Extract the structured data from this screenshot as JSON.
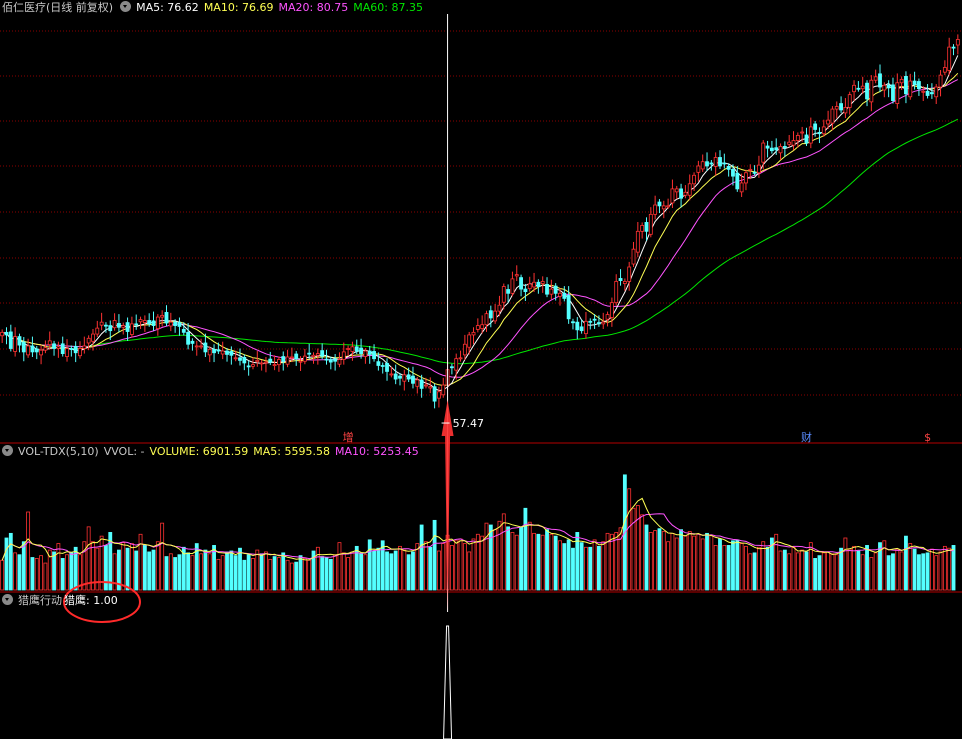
{
  "main_header": {
    "stock_title": "佰仁医疗(日线 前复权)",
    "ma5": "MA5: 76.62",
    "ma10": "MA10: 76.69",
    "ma20": "MA20: 80.75",
    "ma60": "MA60: 87.35"
  },
  "vol_header": {
    "name": "VOL-TDX(5,10)",
    "vvol": "VVOL: -",
    "volume": "VOLUME: 6901.59",
    "ma5": "MA5: 5595.58",
    "ma10": "MA10: 5253.45"
  },
  "ind_header": {
    "name": "猎鹰行动",
    "value_label": "猎鹰",
    "value": ": 1.00"
  },
  "colors": {
    "up": "#ff3232",
    "down": "#54ffff",
    "ma5": "#ffffff",
    "ma10": "#ffff54",
    "ma20": "#ff54ff",
    "ma60": "#00e600",
    "grid": "#8b0000",
    "arrow": "#ff3333",
    "circle": "#ff2a2a",
    "marker_left": "#ff4444",
    "marker_mid": "#5a8cff",
    "marker_right": "#ff4444"
  },
  "chart_data": [
    {
      "type": "candlestick",
      "title": "佰仁医疗(日线 前复权)",
      "ylim": [
        55,
        104
      ],
      "low_annotation": "57.47",
      "low_value": 57.47,
      "event_markers": [
        "增",
        "财",
        "$"
      ],
      "series": [
        {
          "name": "MA5",
          "legend": "MA5: 76.62"
        },
        {
          "name": "MA10",
          "legend": "MA10: 76.69"
        },
        {
          "name": "MA20",
          "legend": "MA20: 80.75"
        },
        {
          "name": "MA60",
          "legend": "MA60: 87.35"
        }
      ],
      "close": [
        66.5,
        66.2,
        64.6,
        66.0,
        65.0,
        64.2,
        64.9,
        64.2,
        64.2,
        64.4,
        64.7,
        65.5,
        64.6,
        64.8,
        64.0,
        64.6,
        64.5,
        64.1,
        64.6,
        64.9,
        65.8,
        66.3,
        67.0,
        67.7,
        67.3,
        66.7,
        67.9,
        67.1,
        67.3,
        66.6,
        67.5,
        67.4,
        68.0,
        67.9,
        67.5,
        67.3,
        68.3,
        68.5,
        67.6,
        67.7,
        67.3,
        67.2,
        66.5,
        65.1,
        65.2,
        64.9,
        64.9,
        64.2,
        64.5,
        64.1,
        64.3,
        64.3,
        63.9,
        63.8,
        63.5,
        63.2,
        62.9,
        62.5,
        62.7,
        63.2,
        62.9,
        63.0,
        63.0,
        62.7,
        63.3,
        63.1,
        63.6,
        63.6,
        63.4,
        63.1,
        63.7,
        64.0,
        63.8,
        64.0,
        63.7,
        63.3,
        63.0,
        63.1,
        63.3,
        64.2,
        64.6,
        64.8,
        64.3,
        64.0,
        64.3,
        63.9,
        63.4,
        62.6,
        62.5,
        61.9,
        61.6,
        61.0,
        61.1,
        61.5,
        61.0,
        60.5,
        60.9,
        59.9,
        60.3,
        60.1,
        58.4,
        59.5,
        60.3,
        62.1,
        62.4,
        63.4,
        63.5,
        65.1,
        66.2,
        66.5,
        67.3,
        67.4,
        68.7,
        68.2,
        69.0,
        69.7,
        71.9,
        71.1,
        72.8,
        73.3,
        71.6,
        71.3,
        72.2,
        72.4,
        71.9,
        72.5,
        71.0,
        71.6,
        71.1,
        71.1,
        70.5,
        68.1,
        67.7,
        66.8,
        66.7,
        67.8,
        67.7,
        68.0,
        67.5,
        67.7,
        68.6,
        70.0,
        72.5,
        72.6,
        72.5,
        74.2,
        76.3,
        78.4,
        79.1,
        78.4,
        80.4,
        81.5,
        81.4,
        81.4,
        81.4,
        83.4,
        83.4,
        82.3,
        83.0,
        84.0,
        85.0,
        86.1,
        86.6,
        86.1,
        86.4,
        87.1,
        86.1,
        86.4,
        85.7,
        84.9,
        83.4,
        84.1,
        85.3,
        85.7,
        85.3,
        86.2,
        88.8,
        88.2,
        87.9,
        88.0,
        88.4,
        88.3,
        88.9,
        89.1,
        89.7,
        90.1,
        88.8,
        90.7,
        90.4,
        89.9,
        90.7,
        91.5,
        92.8,
        93.1,
        92.7,
        93.0,
        94.5,
        95.6,
        95.2,
        95.5,
        94.0,
        96.2,
        96.6,
        95.4,
        95.6,
        95.3,
        93.8,
        95.9,
        96.3,
        94.6,
        96.1,
        95.7,
        95.2,
        94.9,
        94.4,
        94.6,
        95.4,
        96.8,
        97.7,
        100.1,
        100.0,
        101.0
      ],
      "volume": [
        3200,
        5600,
        6100,
        4000,
        3800,
        5200,
        8400,
        3500,
        3400,
        3700,
        2900,
        4300,
        4100,
        5000,
        3400,
        3800,
        4000,
        4600,
        3800,
        5200,
        6800,
        5200,
        4500,
        5800,
        4800,
        6200,
        3900,
        4300,
        5100,
        4500,
        5000,
        4200,
        6000,
        4800,
        4100,
        4300,
        5200,
        7200,
        3600,
        3900,
        3500,
        3800,
        4600,
        4000,
        3700,
        5000,
        3900,
        4300,
        3900,
        4800,
        3300,
        3700,
        4100,
        4200,
        3700,
        4500,
        3200,
        3800,
        3400,
        4300,
        3900,
        4100,
        3300,
        3600,
        3500,
        4000,
        3200,
        2900,
        3000,
        3700,
        3400,
        3200,
        4200,
        4600,
        3600,
        3500,
        3300,
        3800,
        5100,
        4000,
        3500,
        4100,
        4700,
        3900,
        3800,
        5400,
        4200,
        4500,
        5300,
        4100,
        3900,
        4200,
        4700,
        4300,
        3800,
        4100,
        5000,
        7000,
        5200,
        4600,
        7500,
        4200,
        5000,
        5900,
        4800,
        5300,
        5500,
        5000,
        4100,
        5500,
        6000,
        5800,
        7200,
        7000,
        6500,
        7400,
        8200,
        6800,
        6200,
        5900,
        6800,
        8800,
        7300,
        6100,
        6000,
        5900,
        6500,
        6000,
        5800,
        5300,
        5000,
        5400,
        4500,
        6200,
        5100,
        4600,
        4600,
        5400,
        4700,
        5200,
        6100,
        6000,
        6200,
        6700,
        12400,
        10900,
        8800,
        9100,
        8100,
        7000,
        6200,
        6400,
        6600,
        6300,
        5200,
        6100,
        5600,
        6500,
        5800,
        6300,
        5800,
        6000,
        5500,
        6100,
        5900,
        4800,
        5500,
        4800,
        4800,
        5300,
        5400,
        5000,
        4700,
        3900,
        4000,
        4600,
        5200,
        4600,
        5600,
        6000,
        4200,
        4300,
        3900,
        4600,
        4000,
        4300,
        4100,
        5100,
        3400,
        3700,
        4000,
        4100,
        3900,
        3800,
        4500,
        5600,
        4400,
        4700,
        4200,
        3800,
        4800,
        3500,
        4000,
        5100,
        5300,
        3700,
        3900,
        4400,
        4100,
        5800,
        5000,
        4400,
        3800,
        3900,
        4000,
        4400,
        3700,
        4100,
        4700,
        4500,
        4800
      ]
    },
    {
      "type": "bar",
      "title": "VOL-TDX(5,10)",
      "ylim": [
        0,
        14000
      ],
      "series": [
        {
          "name": "VOLUME",
          "legend": "VOLUME: 6901.59"
        },
        {
          "name": "MA5",
          "legend": "MA5: 5595.58"
        },
        {
          "name": "MA10",
          "legend": "MA10: 5253.45"
        }
      ]
    },
    {
      "type": "signal",
      "title": "猎鹰行动",
      "series": [
        {
          "name": "猎鹰",
          "value": 1.0
        }
      ],
      "signal_index": 103
    }
  ]
}
